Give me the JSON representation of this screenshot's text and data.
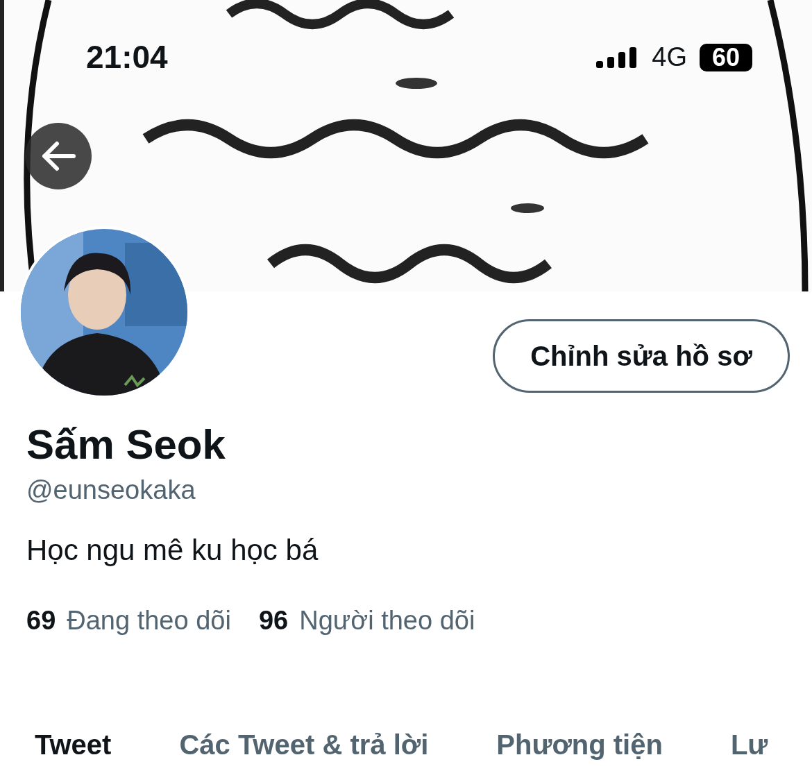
{
  "status_bar": {
    "time": "21:04",
    "network": "4G",
    "battery": "60"
  },
  "edit_button": {
    "label": "Chỉnh sửa hồ sơ"
  },
  "profile": {
    "name": "Sấm Seok",
    "handle": "@eunseokaka",
    "bio": "Học ngu mê ku học bá"
  },
  "stats": [
    {
      "count": "69",
      "label": "Đang theo dõi"
    },
    {
      "count": "96",
      "label": "Người theo dõi"
    }
  ],
  "tabs": [
    {
      "label": "Tweet",
      "selected": true
    },
    {
      "label": "Các Tweet & trả lời",
      "selected": false
    },
    {
      "label": "Phương tiện",
      "selected": false
    },
    {
      "label": "Lư",
      "selected": false
    }
  ]
}
